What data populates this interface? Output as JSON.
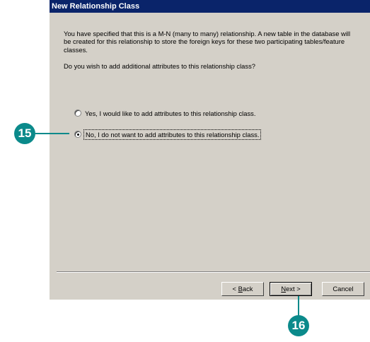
{
  "dialog": {
    "title": "New Relationship Class",
    "description": "You have specified that this is a M-N (many to many) relationship. A new table in the database will be created for this relationship to store the foreign keys for these two participating tables/feature classes.",
    "question": "Do you wish to add additional attributes to this relationship class?",
    "options": [
      {
        "label": "Yes, I would like to add attributes to this relationship class.",
        "checked": false
      },
      {
        "label": "No, I do not want to add attributes to this relationship class.",
        "checked": true
      }
    ],
    "buttons": {
      "back": {
        "prefix": "< ",
        "mnemonic": "B",
        "rest": "ack"
      },
      "next": {
        "mnemonic": "N",
        "rest": "ext >"
      },
      "cancel": "Cancel"
    }
  },
  "callouts": {
    "step_15": "15",
    "step_16": "16"
  },
  "colors": {
    "title_bar": "#0a246a",
    "dialog_face": "#d4d0c8",
    "callout": "#0b8a8b"
  }
}
